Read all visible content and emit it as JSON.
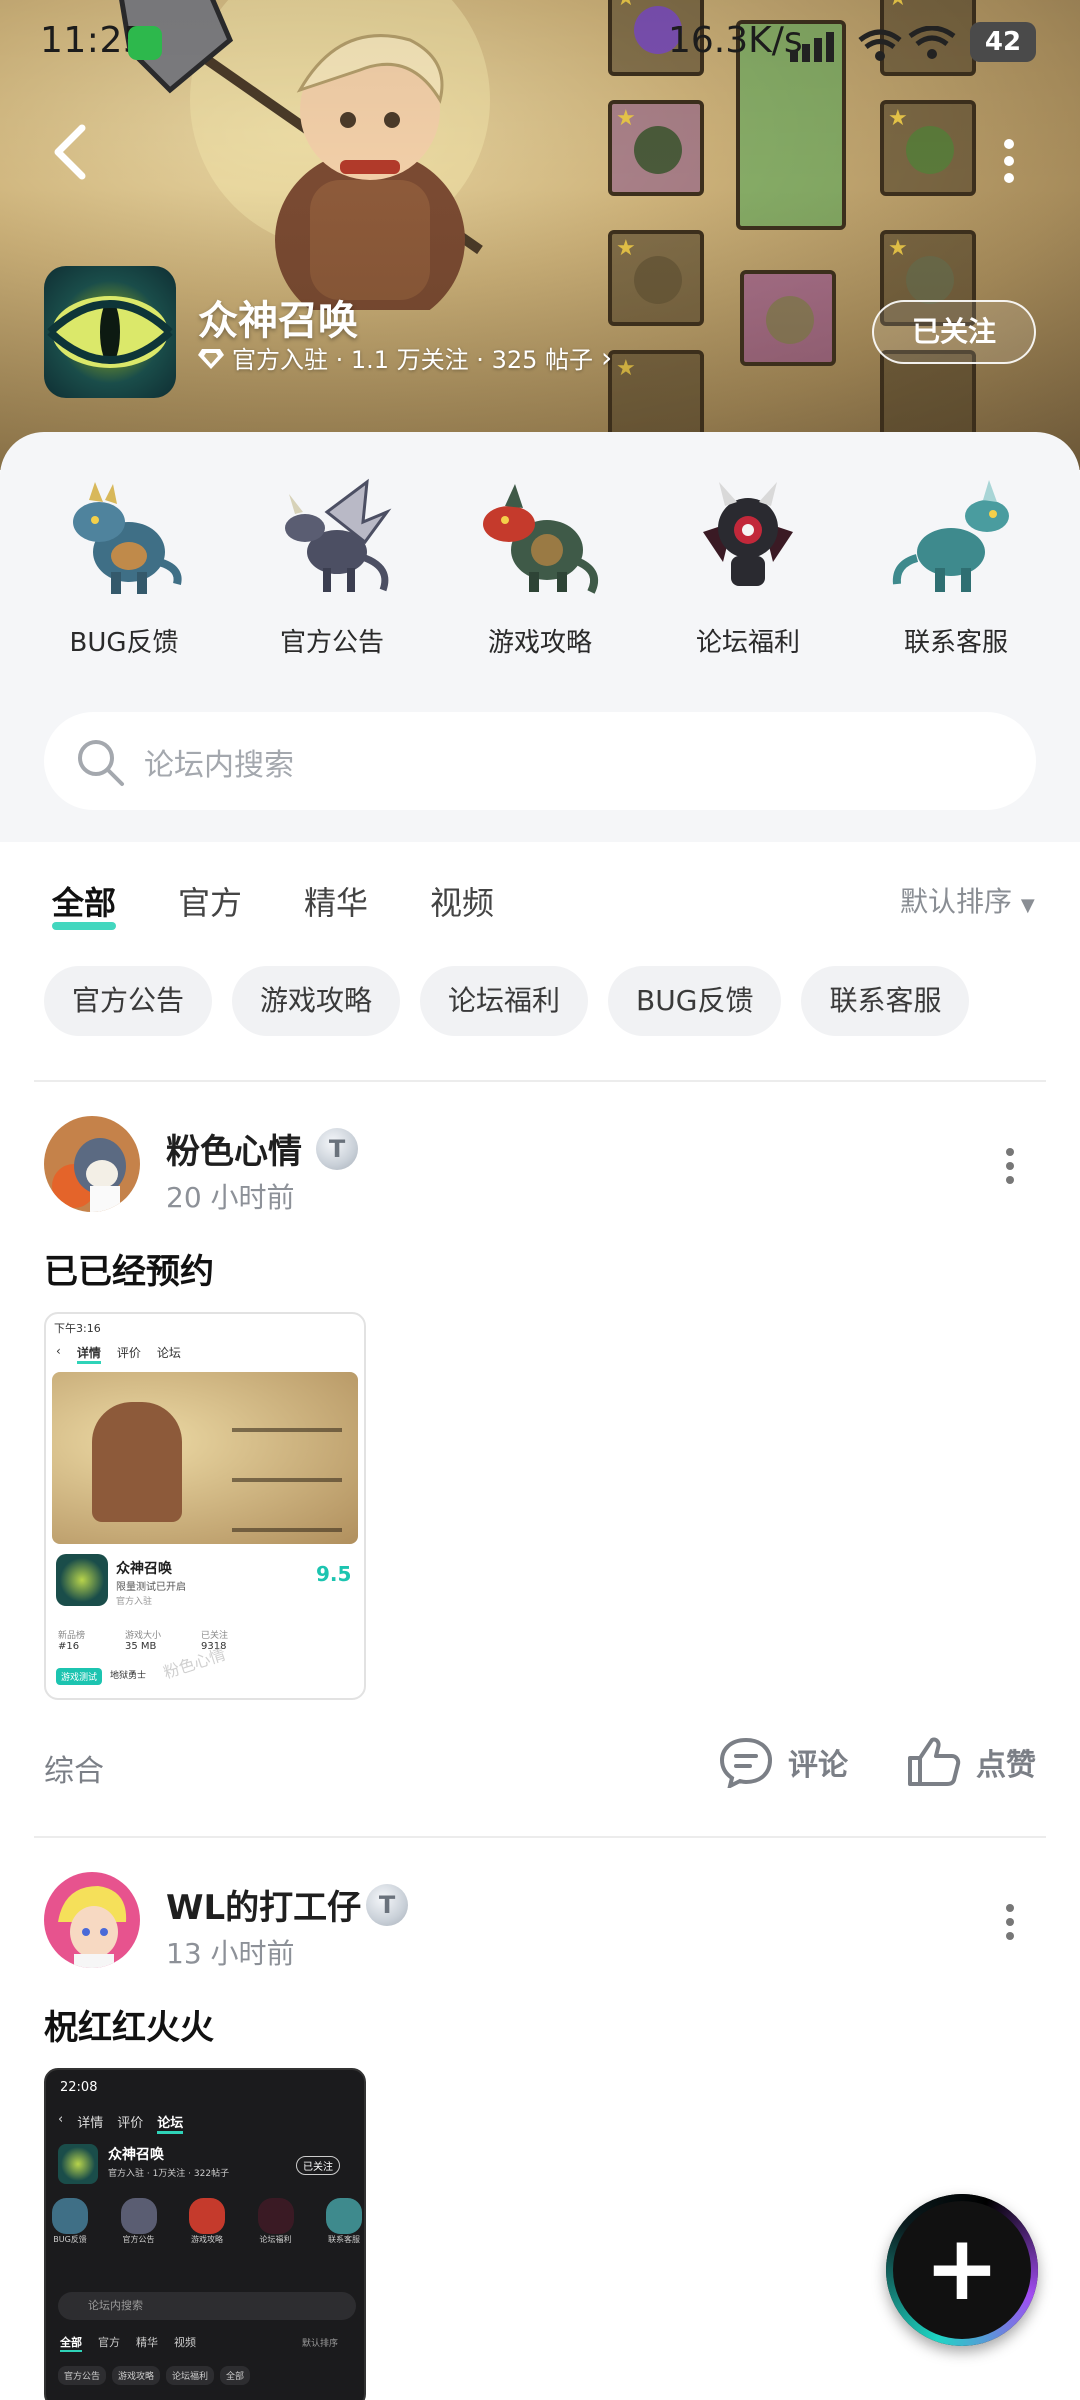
{
  "status_bar": {
    "time": "11:25",
    "net_speed": "16.3K/s",
    "battery": "42"
  },
  "header": {
    "game_title": "众神召唤",
    "meta": "官方入驻 · 1.1 万关注 · 325 帖子",
    "follow_label": "已关注"
  },
  "categories": [
    {
      "label": "BUG反馈",
      "icon": "blue-dragon-icon",
      "color": "#3f6f86"
    },
    {
      "label": "官方公告",
      "icon": "winged-dragon-icon",
      "color": "#4c4f63"
    },
    {
      "label": "游戏攻略",
      "icon": "red-head-dragon-icon",
      "color": "#c53a2c"
    },
    {
      "label": "论坛福利",
      "icon": "dark-demon-icon",
      "color": "#2a2a30"
    },
    {
      "label": "联系客服",
      "icon": "teal-dragon-icon",
      "color": "#3e8a8d"
    }
  ],
  "search": {
    "placeholder": "论坛内搜索"
  },
  "tabs": [
    {
      "label": "全部",
      "active": true
    },
    {
      "label": "官方",
      "active": false
    },
    {
      "label": "精华",
      "active": false
    },
    {
      "label": "视频",
      "active": false
    }
  ],
  "sort_label": "默认排序",
  "chips": [
    "官方公告",
    "游戏攻略",
    "论坛福利",
    "BUG反馈",
    "联系客服"
  ],
  "posts": [
    {
      "user": "粉色心情",
      "level_badge": "T",
      "time": "20 小时前",
      "title": "已已经预约",
      "tag": "综合",
      "comment_label": "评论",
      "like_label": "点赞",
      "thumb": {
        "status_time": "下午3:16",
        "tabs": [
          "详情",
          "评价",
          "论坛"
        ],
        "game_title": "众神召唤",
        "game_sub": "限量测试已开启",
        "official": "官方入驻",
        "rating": "9.5",
        "stats": [
          {
            "label": "新品榜",
            "value": "#16"
          },
          {
            "label": "游戏大小",
            "value": "35 MB"
          },
          {
            "label": "已关注",
            "value": "9318"
          }
        ],
        "tag1": "游戏测试",
        "tag2": "地狱勇士",
        "watermark": "粉色心情"
      }
    },
    {
      "user": "WL的打工仔",
      "level_badge": "T",
      "time": "13 小时前",
      "title": "柷红红火火",
      "thumb": {
        "status_time": "22:08",
        "tabs": [
          "详情",
          "评价",
          "论坛"
        ],
        "game_title": "众神召唤",
        "game_meta": "官方入驻 · 1万关注 · 322帖子",
        "follow_label": "已关注",
        "cats": [
          "BUG反馈",
          "官方公告",
          "游戏攻略",
          "论坛福利",
          "联系客服"
        ],
        "search": "论坛内搜索",
        "tabs2": [
          "全部",
          "官方",
          "精华",
          "视频"
        ],
        "sort": "默认排序",
        "chips": [
          "官方公告",
          "游戏攻略",
          "论坛福利",
          "全部"
        ]
      }
    }
  ],
  "fab_label": "+"
}
